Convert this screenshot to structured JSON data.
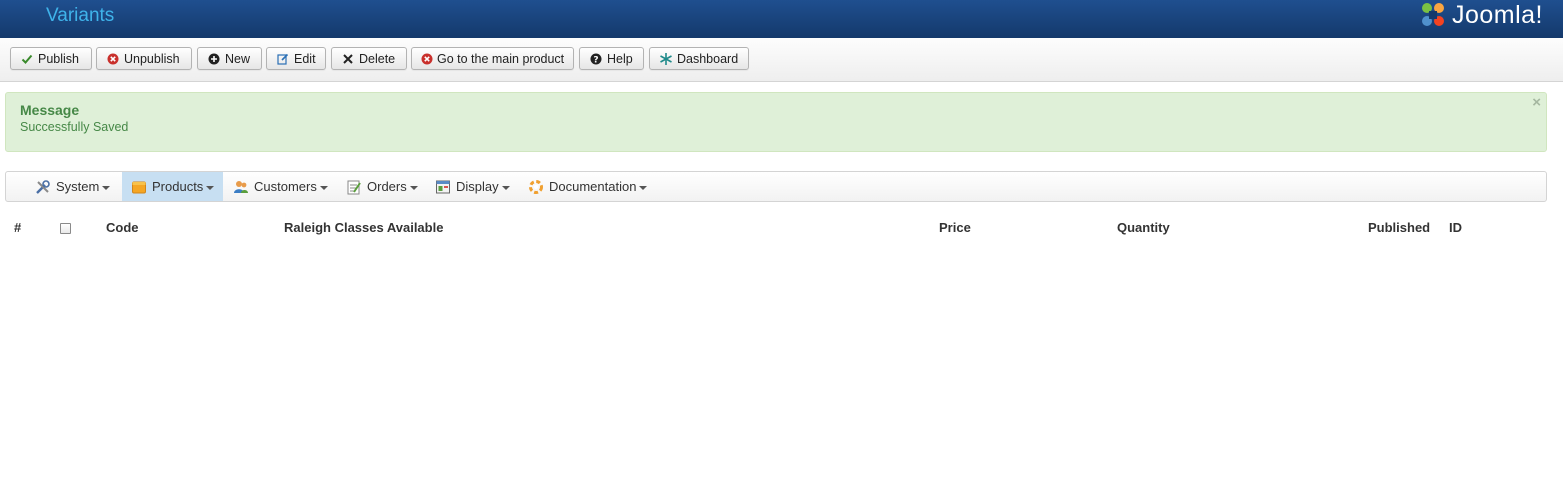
{
  "header": {
    "title": "Variants",
    "logo_text": "Joomla!"
  },
  "toolbar": {
    "buttons": [
      {
        "label": "Publish",
        "icon": "check-icon",
        "color": "#3a8a2c"
      },
      {
        "label": "Unpublish",
        "icon": "circle-x-icon",
        "color": "#c9302c"
      },
      {
        "label": "New",
        "icon": "plus-circle-icon",
        "color": "#333333"
      },
      {
        "label": "Edit",
        "icon": "edit-icon",
        "color": "#2a6fb5"
      },
      {
        "label": "Delete",
        "icon": "x-icon",
        "color": "#333333"
      },
      {
        "label": "Go to the main product",
        "icon": "circle-x-icon",
        "color": "#c9302c"
      },
      {
        "label": "Help",
        "icon": "question-circle-icon",
        "color": "#333333"
      },
      {
        "label": "Dashboard",
        "icon": "dashboard-icon",
        "color": "#1f8a8a"
      }
    ]
  },
  "message": {
    "heading": "Message",
    "text": "Successfully Saved",
    "close": "×"
  },
  "menu": {
    "items": [
      {
        "label": "System",
        "icon": "tools-icon"
      },
      {
        "label": "Products",
        "icon": "box-icon",
        "active": true
      },
      {
        "label": "Customers",
        "icon": "users-icon"
      },
      {
        "label": "Orders",
        "icon": "orders-icon"
      },
      {
        "label": "Display",
        "icon": "display-icon"
      },
      {
        "label": "Documentation",
        "icon": "documentation-icon"
      }
    ]
  },
  "table": {
    "columns": [
      "#",
      "Code",
      "Raleigh Classes Available",
      "Price",
      "Quantity",
      "Published",
      "ID"
    ]
  }
}
